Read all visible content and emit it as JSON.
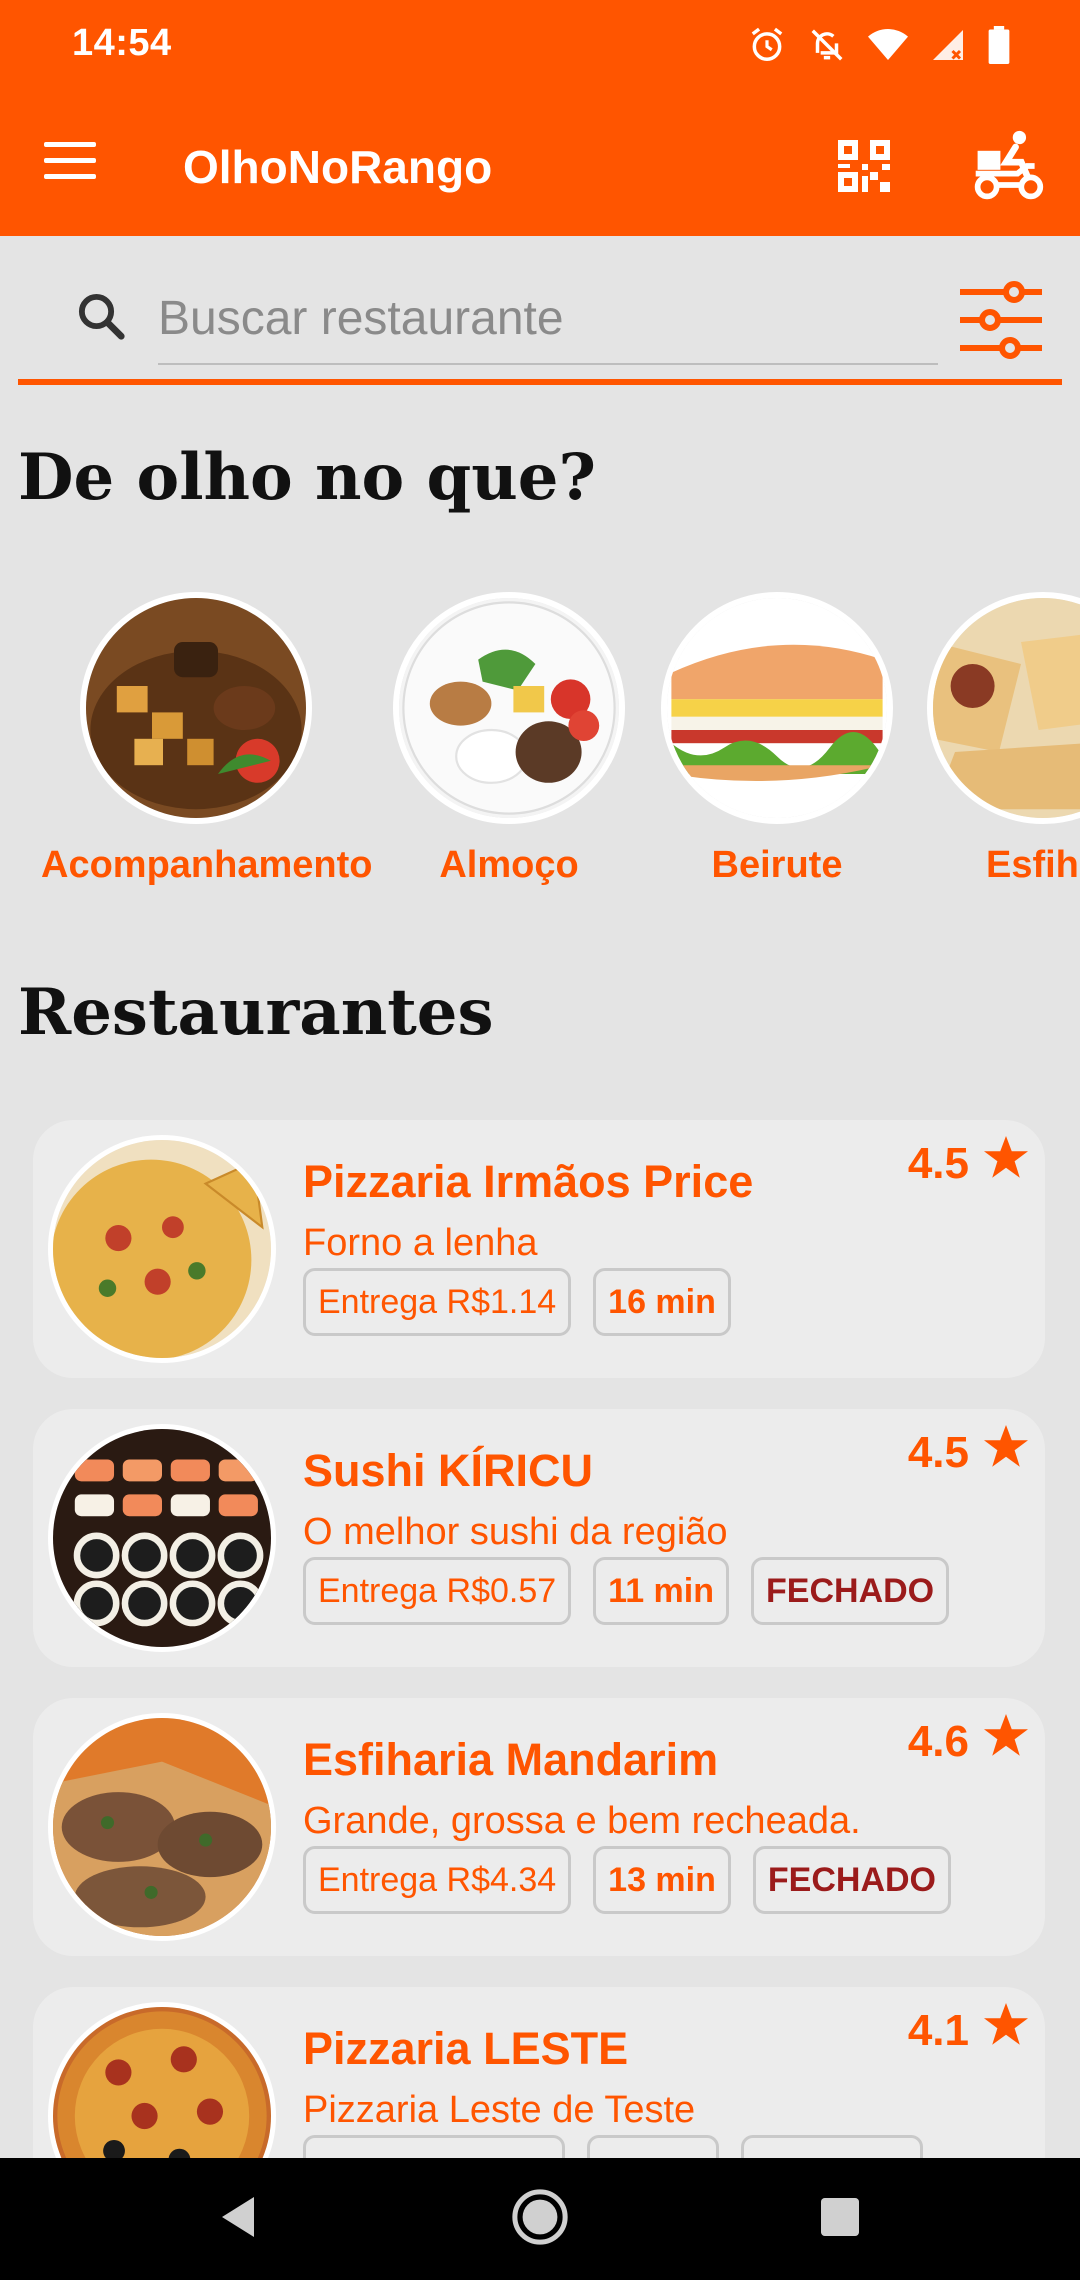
{
  "status_bar": {
    "time": "14:54",
    "icons": [
      "alarm-icon",
      "bell-off-icon",
      "wifi-icon",
      "signal-icon",
      "battery-icon"
    ]
  },
  "app_bar": {
    "title": "OlhoNoRango",
    "icons": [
      "menu-icon",
      "qr-code-icon",
      "delivery-moto-icon"
    ]
  },
  "search": {
    "placeholder": "Buscar restaurante",
    "value": ""
  },
  "categories_section": {
    "title": "De olho no que?",
    "items": [
      {
        "label": "Acompanhamento"
      },
      {
        "label": "Almoço"
      },
      {
        "label": "Beirute"
      },
      {
        "label": "Esfiha"
      }
    ]
  },
  "restaurants_section": {
    "title": "Restaurantes",
    "items": [
      {
        "name": "Pizzaria Irmãos Price",
        "description": "Forno a lenha",
        "delivery": "Entrega R$1.14",
        "time": "16 min",
        "status": "",
        "rating": "4.5"
      },
      {
        "name": "Sushi KÍRICU",
        "description": "O melhor sushi da região",
        "delivery": "Entrega R$0.57",
        "time": "11 min",
        "status": "FECHADO",
        "rating": "4.5"
      },
      {
        "name": "Esfiharia Mandarim",
        "description": "Grande, grossa e bem recheada.",
        "delivery": "Entrega R$4.34",
        "time": "13 min",
        "status": "FECHADO",
        "rating": "4.6"
      },
      {
        "name": "Pizzaria LESTE",
        "description": "Pizzaria Leste de Teste",
        "delivery": "",
        "time": "",
        "status": "",
        "rating": "4.1"
      }
    ]
  },
  "colors": {
    "primary": "#ff5500",
    "background": "#e4e4e4",
    "card": "#ececec",
    "closed": "#9b1b1b"
  }
}
